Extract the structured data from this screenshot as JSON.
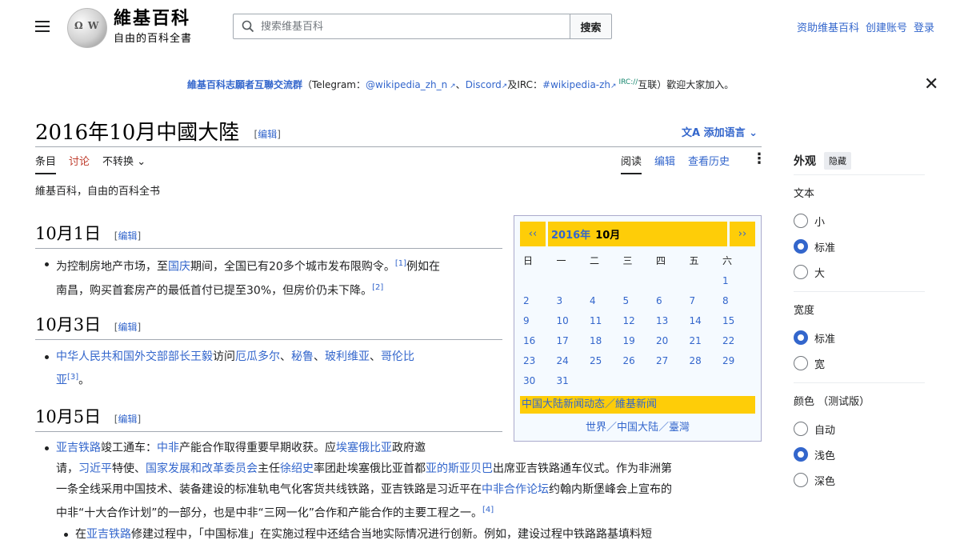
{
  "header": {
    "logo_title": "維基百科",
    "logo_tagline": "自由的百科全書",
    "search_placeholder": "搜索维基百科",
    "search_button": "搜索",
    "user_links": [
      "资助维基百科",
      "创建账号",
      "登录"
    ]
  },
  "notice": {
    "lead": "維基百科志願者互聯交流群",
    "p1": "（Telegram：",
    "telegram": "@wikipedia_zh_n",
    "p2": "、",
    "discord": "Discord",
    "p3": "及IRC：",
    "irc": "#wikipedia-zh",
    "sup": "IRC://",
    "p4": "互联）歡迎大家加入。"
  },
  "page": {
    "title": "2016年10月中國大陸",
    "edit": "编辑",
    "add_languages": "添加语言",
    "tabs_left": [
      "条目",
      "讨论",
      "不转换"
    ],
    "tabs_right": [
      "阅读",
      "编辑",
      "查看历史"
    ],
    "tagline": "維基百科，自由的百科全书"
  },
  "sections": [
    {
      "heading": "10月1日",
      "line1_a": "为控制房地产市场，至",
      "line1_link": "国庆",
      "line1_b": "期间，全国已有20多个城市发布限购令。",
      "ref1": "[1]",
      "line1_c": "例如在",
      "line2": "南昌，购买首套房产的最低首付已提至30%，但房价仍未下降。",
      "ref2": "[2]"
    },
    {
      "heading": "10月3日",
      "l1": "中华人民共和国外交部部长",
      "l2": "王毅",
      "l3": "访问",
      "l4": "厄瓜多尔",
      "sep": "、",
      "l5": "秘鲁",
      "l6": "玻利维亚",
      "l7": "哥伦比",
      "l8": "亚",
      "ref": "[3]",
      "end": "。"
    },
    {
      "heading": "10月5日",
      "a1": "亚吉铁路",
      "a2": "竣工通车：",
      "a3": "中非",
      "a4": "产能合作取得重要早期收获。应",
      "a5": "埃塞俄比亚",
      "a6": "政府邀",
      "b1": "请，",
      "b2": "习近平",
      "b3": "特使、",
      "b4": "国家发展和改革委员会",
      "b5": "主任",
      "b6": "徐绍史",
      "b7": "率团赴埃塞俄比亚首都",
      "b8": "亚的斯亚贝巴",
      "b9": "出席亚吉铁路通车仪式。作为非洲第",
      "c1": "一条全线采用中国技术、装备建设的标准轨电气化客货共线铁路，亚吉铁路是习近平在",
      "c2": "中非合作论坛",
      "c3": "约翰内斯堡峰会上宣布的",
      "d1": "中非“十大合作计划”的一部分，也是中非“三网一化”合作和产能合作的主要工程之一。",
      "dref": "[4]",
      "e1": "在",
      "e2": "亚吉铁路",
      "e3": "修建过程中，「中国标准」在实施过程中还结合当地实际情况进行创新。例如，建设过程中铁路路基填料短"
    }
  ],
  "calendar": {
    "prev": "‹‹",
    "next": "››",
    "month_link": "2016年",
    "month_bold": "10月",
    "weekdays": [
      "日",
      "一",
      "二",
      "三",
      "四",
      "五",
      "六"
    ],
    "days": [
      "",
      "",
      "",
      "",
      "",
      "",
      "1",
      "2",
      "3",
      "4",
      "5",
      "6",
      "7",
      "8",
      "9",
      "10",
      "11",
      "12",
      "13",
      "14",
      "15",
      "16",
      "17",
      "18",
      "19",
      "20",
      "21",
      "22",
      "23",
      "24",
      "25",
      "26",
      "27",
      "28",
      "29",
      "30",
      "31",
      "",
      "",
      "",
      "",
      ""
    ],
    "news": "中国大陆新闻动态／維基新闻",
    "footer": "世界／中国大陆／臺灣"
  },
  "appearance": {
    "title": "外观",
    "hide": "隐藏",
    "text_label": "文本",
    "text_options": [
      "小",
      "标准",
      "大"
    ],
    "text_selected": 1,
    "width_label": "宽度",
    "width_options": [
      "标准",
      "宽"
    ],
    "width_selected": 0,
    "color_label": "颜色 （测试版）",
    "color_options": [
      "自动",
      "浅色",
      "深色"
    ],
    "color_selected": 1
  },
  "colors": {
    "link": "#3366cc",
    "calendar_gold": "#fecd08",
    "red_link": "#bf3c2c"
  }
}
